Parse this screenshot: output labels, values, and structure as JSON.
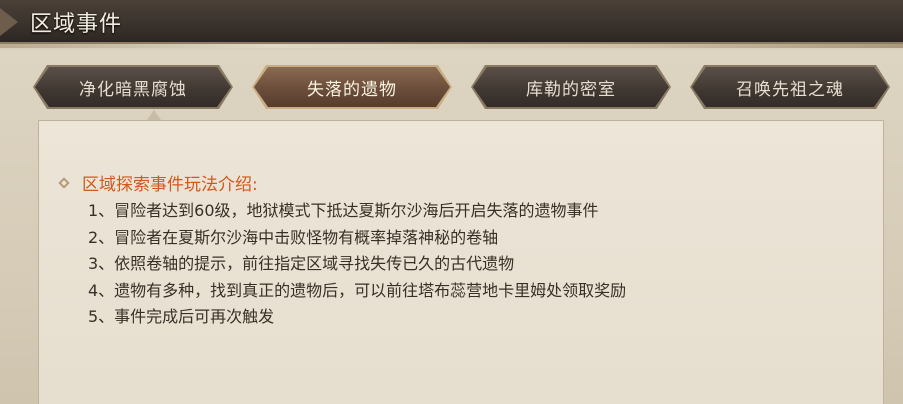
{
  "header": {
    "title": "区域事件"
  },
  "tabs": [
    {
      "label": "净化暗黑腐蚀",
      "active": false
    },
    {
      "label": "失落的遗物",
      "active": true
    },
    {
      "label": "库勒的密室",
      "active": false
    },
    {
      "label": "召唤先祖之魂",
      "active": false
    }
  ],
  "content": {
    "heading": "区域探索事件玩法介绍:",
    "items": [
      "1、冒险者达到60级，地狱模式下抵达夏斯尔沙海后开启失落的遗物事件",
      "2、冒险者在夏斯尔沙海中击败怪物有概率掉落神秘的卷轴",
      "3、依照卷轴的提示，前往指定区域寻找失传已久的古代遗物",
      "4、遗物有多种，找到真正的遗物后，可以前往塔布蕊营地卡里姆处领取奖励",
      "5、事件完成后可再次触发"
    ]
  },
  "colors": {
    "heading": "#d2581c",
    "body_text": "#3a2f26",
    "active_tab": "#6b4d3a",
    "inactive_tab": "#3f3731"
  },
  "icons": {
    "heading_bullet": "diamond-icon"
  }
}
